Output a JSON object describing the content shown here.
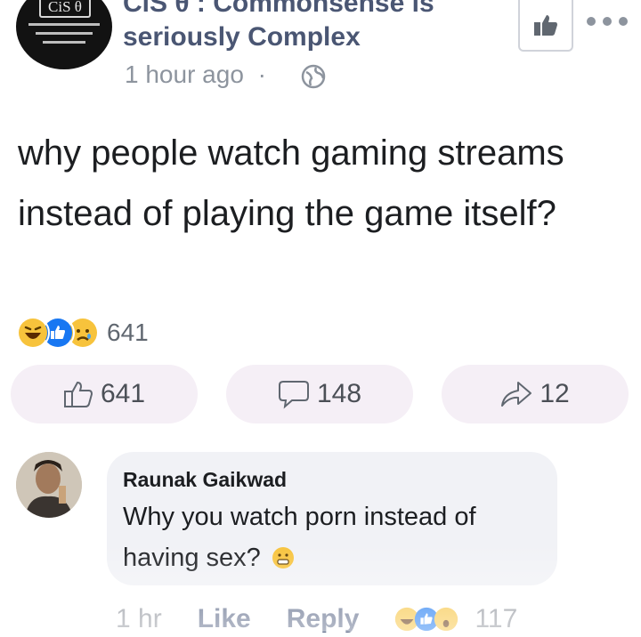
{
  "post": {
    "page_name_line1": "CiS θ : Commonsense is",
    "page_name_line2": "seriously Complex",
    "avatar_brand": "CiS θ",
    "time": "1 hour ago",
    "separator": "·",
    "text": "why people watch gaming streams instead of playing the game itself?"
  },
  "reactions": {
    "count": "641",
    "icons": [
      "haha-icon",
      "like-icon",
      "sad-icon"
    ]
  },
  "actions": {
    "like_count": "641",
    "comment_count": "148",
    "share_count": "12"
  },
  "comment": {
    "author": "Raunak Gaikwad",
    "text": "Why you watch porn instead of having sex?",
    "time": "1 hr",
    "like_label": "Like",
    "reply_label": "Reply",
    "reaction_count": "117"
  },
  "colors": {
    "link": "#4a5673",
    "pill_bg": "#f5eff6",
    "bubble_bg": "#f1f2f6",
    "like_blue": "#1877f2",
    "emoji_yellow": "#f7c33c"
  }
}
